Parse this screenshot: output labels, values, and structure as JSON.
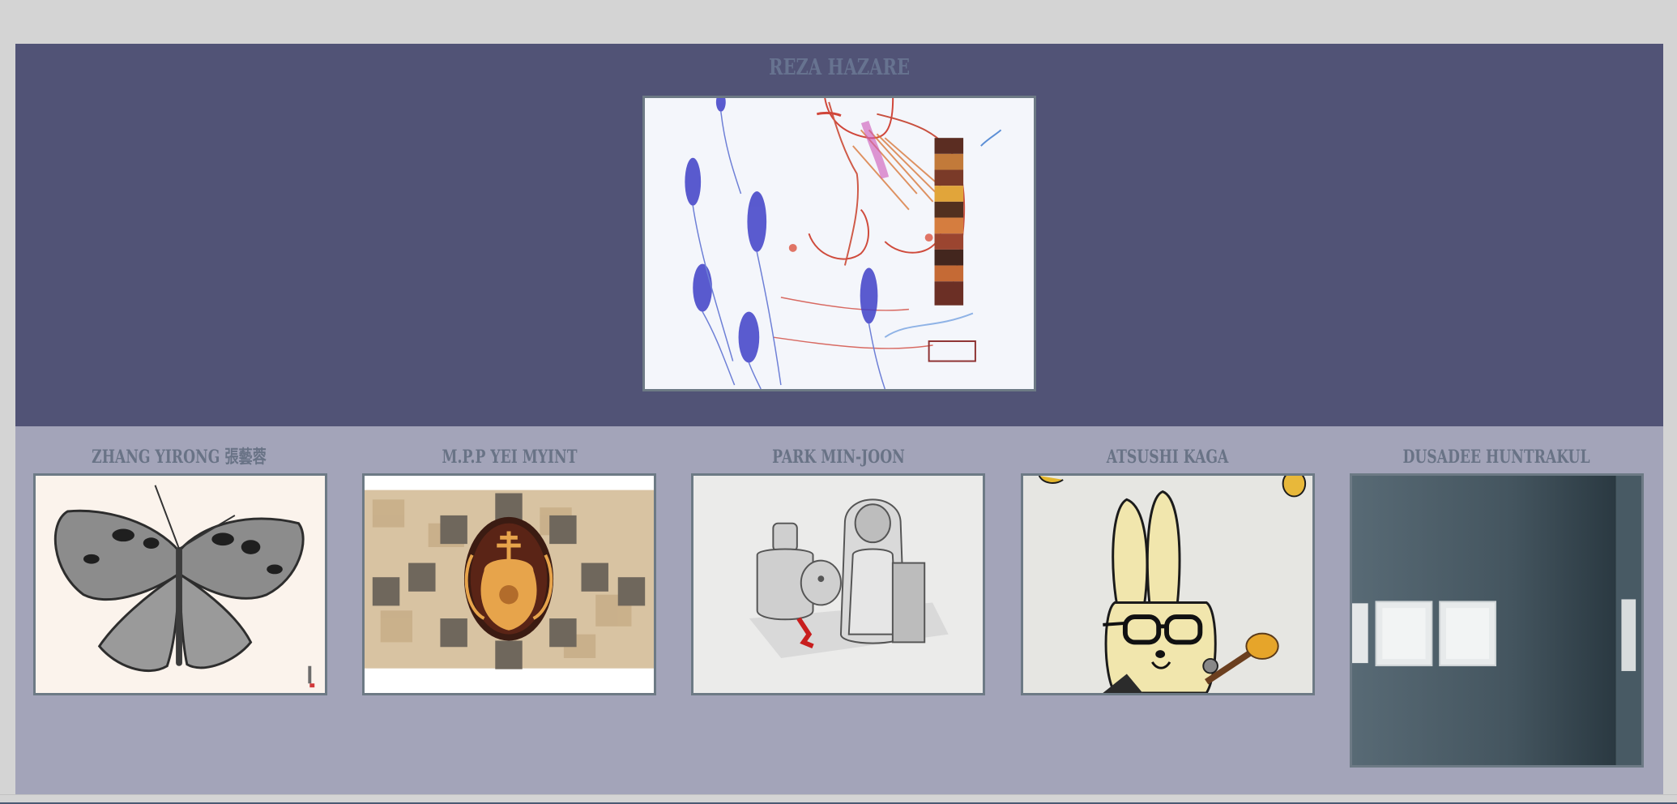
{
  "featured": {
    "artist": "REZA HAZARE",
    "artwork_icon": "drawing-figure-with-blue-plants"
  },
  "grid": {
    "items": [
      {
        "artist": "ZHANG YIRONG 張藝蓉",
        "artwork_icon": "butterfly-drawing"
      },
      {
        "artist": "M.P.P YEI MYINT",
        "artwork_icon": "ornamental-vase-collage"
      },
      {
        "artist": "PARK MIN-JOON",
        "artwork_icon": "pencil-dolls-drawing"
      },
      {
        "artist": "ATSUSHI KAGA",
        "artwork_icon": "bunny-with-glasses-painting"
      },
      {
        "artist": "DUSADEE HUNTRAKUL",
        "artwork_icon": "gallery-wall-photo"
      }
    ]
  },
  "colors": {
    "page_background": "#d4d4d4",
    "hero_background": "#515376",
    "grid_background": "#a3a4b9",
    "name_text": "#697386",
    "frame_border": "#6d7a85"
  }
}
